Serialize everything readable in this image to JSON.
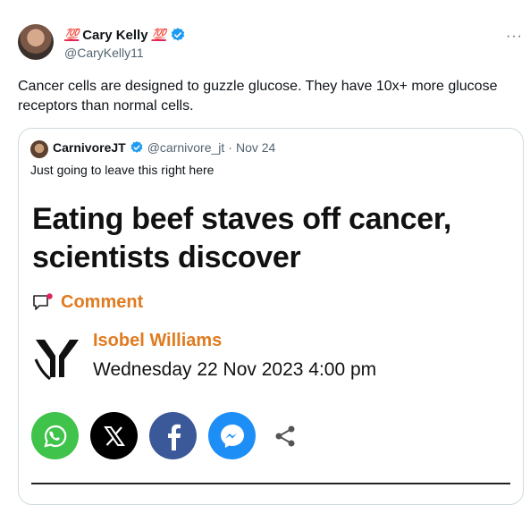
{
  "tweet": {
    "emoji_prefix": "💯",
    "display_name": "Cary Kelly",
    "emoji_suffix": "💯",
    "handle": "@CaryKelly11",
    "more_label": "···",
    "text": "Cancer cells are designed to guzzle glucose. They have 10x+ more glucose receptors than normal cells."
  },
  "quote": {
    "display_name": "CarnivoreJT",
    "handle": "@carnivore_jt",
    "separator": "·",
    "date": "Nov 24",
    "text": "Just going to leave this right here",
    "article": {
      "headline": "Eating beef staves off cancer, scientists discover",
      "comment_label": "Comment",
      "author": "Isobel Williams",
      "published": "Wednesday 22 Nov 2023 4:00 pm"
    },
    "share_icons": [
      "whatsapp-icon",
      "x-icon",
      "facebook-icon",
      "messenger-icon",
      "share-icon"
    ]
  },
  "colors": {
    "accent_orange": "#e07b1f",
    "verified_blue": "#1d9bf0",
    "whatsapp": "#3fc34a",
    "x": "#000000",
    "facebook": "#3b5998",
    "messenger": "#1e8ef7",
    "muted_text": "#536471"
  }
}
